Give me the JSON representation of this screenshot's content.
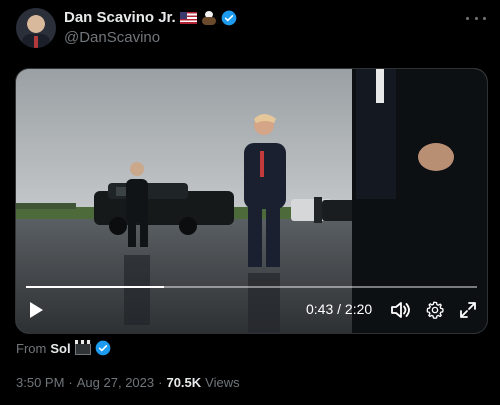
{
  "author": {
    "display_name": "Dan Scavino Jr.",
    "handle": "@DanScavino",
    "name_emojis": [
      "us-flag-icon",
      "eagle-icon"
    ],
    "verified": true
  },
  "video": {
    "current_time": "0:43",
    "separator": "/",
    "duration": "2:20",
    "progress": 0.307
  },
  "source": {
    "prefix": "From",
    "name": "Sol",
    "emoji": "clapper-board-icon",
    "verified": true
  },
  "meta": {
    "time": "3:50 PM",
    "dot": "·",
    "date": "Aug 27, 2023",
    "dot2": "·",
    "views_count": "70.5K",
    "views_label": "Views"
  },
  "colors": {
    "background": "#000000",
    "text_primary": "#e7e9ea",
    "text_secondary": "#71767b",
    "verified_blue": "#1d9bf0"
  }
}
